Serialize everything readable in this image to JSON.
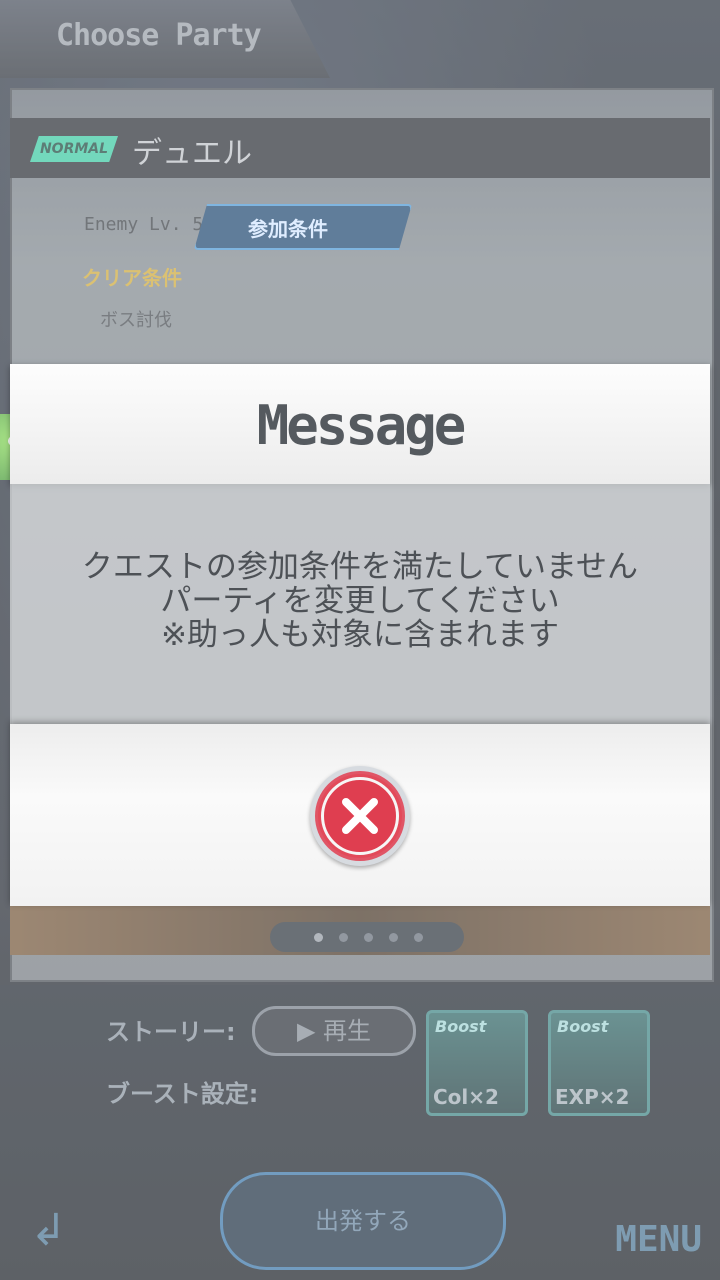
{
  "header": {
    "title": "Choose Party"
  },
  "quest": {
    "difficulty_badge": "NORMAL",
    "name": "デュエル",
    "enemy_level": "Enemy Lv. 50",
    "condition_button": "参加条件",
    "clear_condition_label": "クリア条件",
    "clear_condition_value": "ボス討伐"
  },
  "pager": {
    "pages": 5,
    "active": 1
  },
  "bottom": {
    "story_label": "ストーリー:",
    "play_button": "▶ 再生",
    "boost_label": "ブースト設定:",
    "boost_cards": [
      {
        "title": "Boost",
        "badge": "Col×2"
      },
      {
        "title": "Boost",
        "badge": "EXP×2"
      }
    ],
    "depart_button": "出発する",
    "menu_label": "MENU"
  },
  "modal": {
    "title": "Message",
    "message_lines": [
      "クエストの参加条件を満たしていません",
      "パーティを変更してください",
      "※助っ人も対象に含まれます"
    ],
    "close_button_icon": "close-x-icon",
    "close_color": "#df3e50"
  }
}
